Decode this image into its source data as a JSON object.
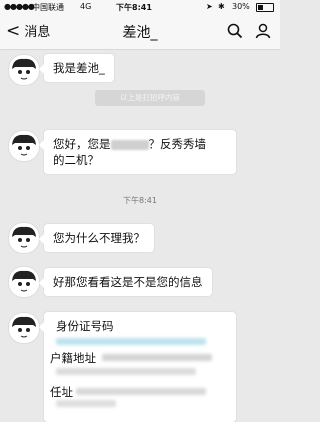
{
  "status_bar": {
    "carrier": "中国联通",
    "network": "4G",
    "time": "下午8:41",
    "battery": "30%"
  },
  "header": {
    "back_label": "消息",
    "title": "差池_"
  },
  "messages": {
    "m1": "我是差池_",
    "system_notice": "以上是打招呼内容",
    "m2_part1": "您好，您是",
    "m2_part2": "？反秀秀墙",
    "m2_line2": "的二机？",
    "time_divider": "下午8:41",
    "m3": "您为什么不理我？",
    "m4": "好那您看看这是不是您的信息",
    "m5_id_label": "身份证号码",
    "m5_residence_label": "户籍地址",
    "m5_address_label": "任址"
  }
}
